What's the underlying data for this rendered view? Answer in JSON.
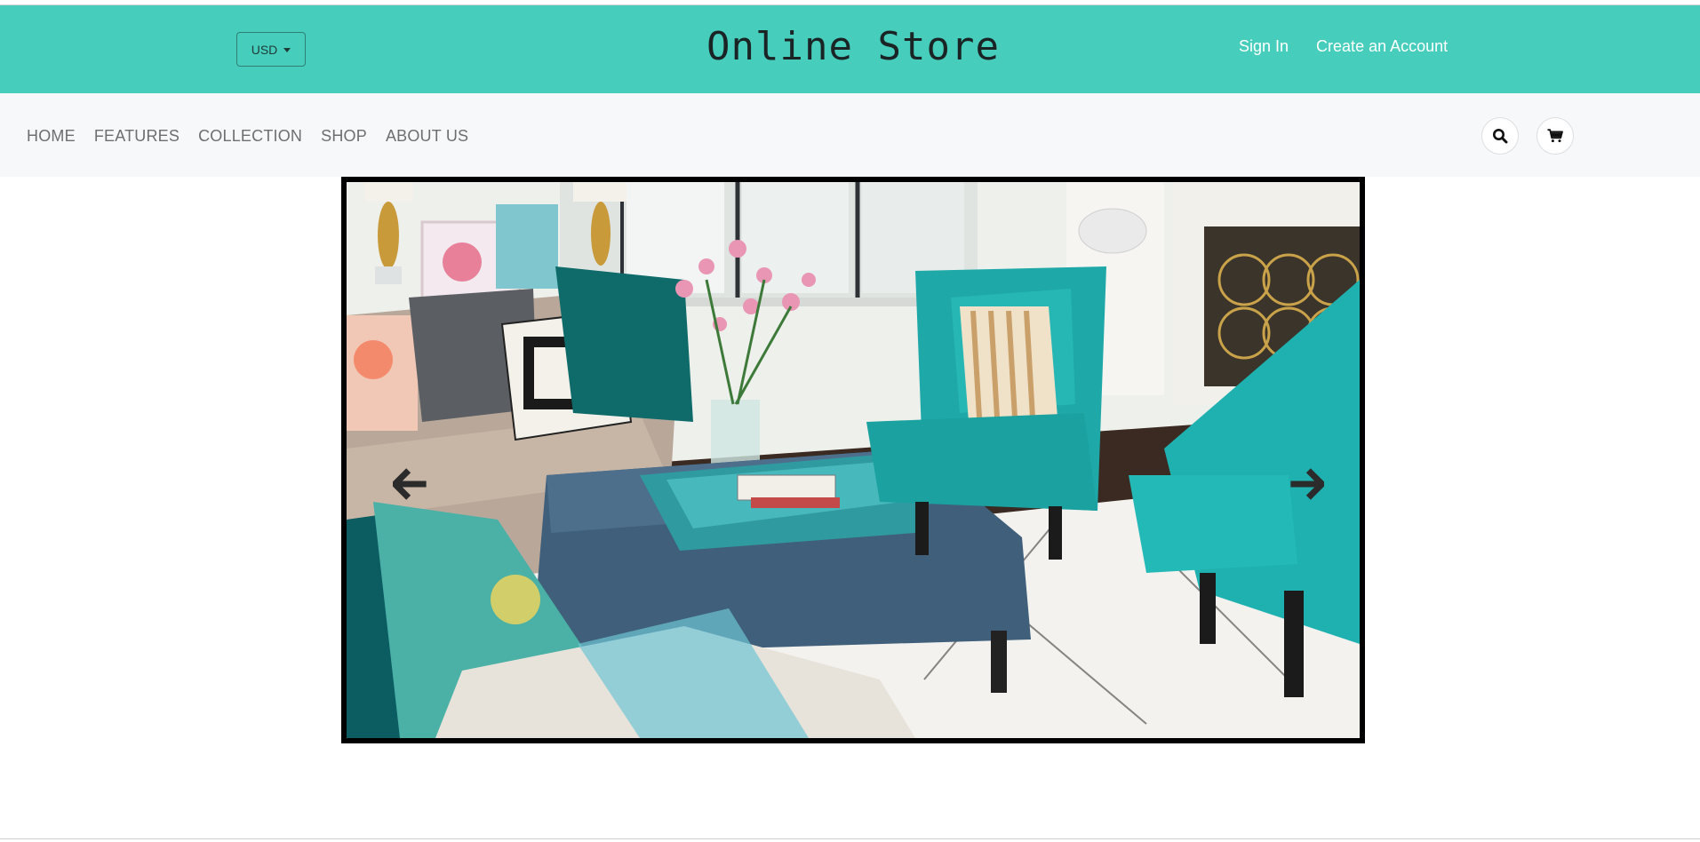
{
  "header": {
    "currency": {
      "selected": "USD"
    },
    "store_title": "Online Store",
    "sign_in_label": "Sign In",
    "create_account_label": "Create an Account"
  },
  "nav": {
    "items": [
      {
        "label": "HOME"
      },
      {
        "label": "FEATURES"
      },
      {
        "label": "COLLECTION"
      },
      {
        "label": "SHOP"
      },
      {
        "label": "ABOUT US"
      }
    ],
    "icons": [
      "search-icon",
      "cart-icon"
    ]
  },
  "hero": {
    "image_alt": "Living room with turquoise armchairs, beige sofa, navy tufted ottoman and flowers",
    "controls": [
      "arrow-left-icon",
      "arrow-right-icon"
    ]
  },
  "colors": {
    "topbar": "#46cdbc",
    "navbar": "#f7f8f9",
    "title_text": "#1a2424",
    "link_text": "#ffffff",
    "nav_text": "#6c6f72",
    "frame": "#000000"
  }
}
